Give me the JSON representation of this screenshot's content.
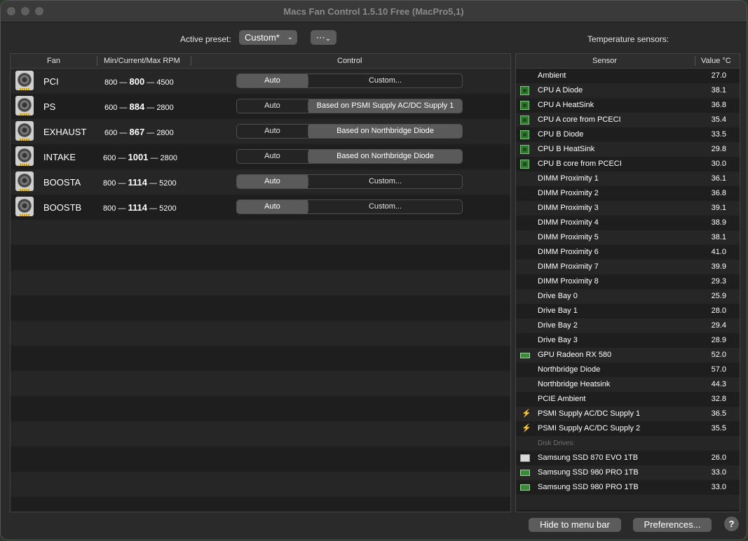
{
  "window": {
    "title": "Macs Fan Control 1.5.10 Free (MacPro5,1)"
  },
  "preset": {
    "label": "Active preset:",
    "value": "Custom*",
    "more_icon": "ellipsis-circle-icon"
  },
  "sensors_heading": "Temperature sensors:",
  "fan_table": {
    "headers": {
      "fan": "Fan",
      "rpm": "Min/Current/Max RPM",
      "control": "Control"
    },
    "rows": [
      {
        "name": "PCI",
        "min": "800",
        "current": "800",
        "max": "4500",
        "auto": "Auto",
        "control": "Custom...",
        "mode": "auto"
      },
      {
        "name": "PS",
        "min": "600",
        "current": "884",
        "max": "2800",
        "auto": "Auto",
        "control": "Based on PSMI Supply AC/DC Supply 1",
        "mode": "custom"
      },
      {
        "name": "EXHAUST",
        "min": "600",
        "current": "867",
        "max": "2800",
        "auto": "Auto",
        "control": "Based on Northbridge Diode",
        "mode": "custom"
      },
      {
        "name": "INTAKE",
        "min": "600",
        "current": "1001",
        "max": "2800",
        "auto": "Auto",
        "control": "Based on Northbridge Diode",
        "mode": "custom"
      },
      {
        "name": "BOOSTA",
        "min": "800",
        "current": "1114",
        "max": "5200",
        "auto": "Auto",
        "control": "Custom...",
        "mode": "auto"
      },
      {
        "name": "BOOSTB",
        "min": "800",
        "current": "1114",
        "max": "5200",
        "auto": "Auto",
        "control": "Custom...",
        "mode": "auto"
      }
    ]
  },
  "sensor_table": {
    "headers": {
      "sensor": "Sensor",
      "value": "Value °C"
    },
    "rows": [
      {
        "name": "Ambient",
        "value": "27.0",
        "icon": ""
      },
      {
        "name": "CPU A Diode",
        "value": "38.1",
        "icon": "chip"
      },
      {
        "name": "CPU A HeatSink",
        "value": "36.8",
        "icon": "chip"
      },
      {
        "name": "CPU A core from PCECI",
        "value": "35.4",
        "icon": "chip"
      },
      {
        "name": "CPU B Diode",
        "value": "33.5",
        "icon": "chip"
      },
      {
        "name": "CPU B HeatSink",
        "value": "29.8",
        "icon": "chip"
      },
      {
        "name": "CPU B core from PCECI",
        "value": "30.0",
        "icon": "chip"
      },
      {
        "name": "DIMM Proximity 1",
        "value": "36.1",
        "icon": ""
      },
      {
        "name": "DIMM Proximity 2",
        "value": "36.8",
        "icon": ""
      },
      {
        "name": "DIMM Proximity 3",
        "value": "39.1",
        "icon": ""
      },
      {
        "name": "DIMM Proximity 4",
        "value": "38.9",
        "icon": ""
      },
      {
        "name": "DIMM Proximity 5",
        "value": "38.1",
        "icon": ""
      },
      {
        "name": "DIMM Proximity 6",
        "value": "41.0",
        "icon": ""
      },
      {
        "name": "DIMM Proximity 7",
        "value": "39.9",
        "icon": ""
      },
      {
        "name": "DIMM Proximity 8",
        "value": "29.3",
        "icon": ""
      },
      {
        "name": "Drive Bay 0",
        "value": "25.9",
        "icon": ""
      },
      {
        "name": "Drive Bay 1",
        "value": "28.0",
        "icon": ""
      },
      {
        "name": "Drive Bay 2",
        "value": "29.4",
        "icon": ""
      },
      {
        "name": "Drive Bay 3",
        "value": "28.9",
        "icon": ""
      },
      {
        "name": "GPU Radeon RX 580",
        "value": "52.0",
        "icon": "gpu"
      },
      {
        "name": "Northbridge Diode",
        "value": "57.0",
        "icon": ""
      },
      {
        "name": "Northbridge Heatsink",
        "value": "44.3",
        "icon": ""
      },
      {
        "name": "PCIE Ambient",
        "value": "32.8",
        "icon": ""
      },
      {
        "name": "PSMI Supply AC/DC Supply 1",
        "value": "36.5",
        "icon": "bolt"
      },
      {
        "name": "PSMI Supply AC/DC Supply 2",
        "value": "35.5",
        "icon": "bolt"
      },
      {
        "group": "Disk Drives:"
      },
      {
        "name": "Samsung SSD 870 EVO 1TB",
        "value": "26.0",
        "icon": "disk"
      },
      {
        "name": "Samsung SSD 980 PRO 1TB",
        "value": "33.0",
        "icon": "ssd"
      },
      {
        "name": "Samsung SSD 980 PRO 1TB",
        "value": "33.0",
        "icon": "ssd"
      }
    ]
  },
  "footer": {
    "hide_label": "Hide to menu bar",
    "prefs_label": "Preferences...",
    "help_label": "?"
  }
}
